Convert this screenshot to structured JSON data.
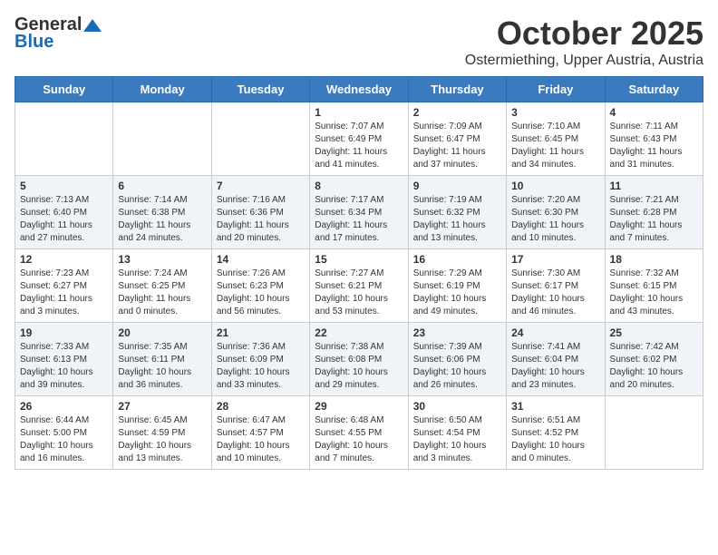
{
  "header": {
    "logo_general": "General",
    "logo_blue": "Blue",
    "month": "October 2025",
    "location": "Ostermiething, Upper Austria, Austria"
  },
  "weekdays": [
    "Sunday",
    "Monday",
    "Tuesday",
    "Wednesday",
    "Thursday",
    "Friday",
    "Saturday"
  ],
  "weeks": [
    [
      {
        "day": "",
        "info": ""
      },
      {
        "day": "",
        "info": ""
      },
      {
        "day": "",
        "info": ""
      },
      {
        "day": "1",
        "info": "Sunrise: 7:07 AM\nSunset: 6:49 PM\nDaylight: 11 hours\nand 41 minutes."
      },
      {
        "day": "2",
        "info": "Sunrise: 7:09 AM\nSunset: 6:47 PM\nDaylight: 11 hours\nand 37 minutes."
      },
      {
        "day": "3",
        "info": "Sunrise: 7:10 AM\nSunset: 6:45 PM\nDaylight: 11 hours\nand 34 minutes."
      },
      {
        "day": "4",
        "info": "Sunrise: 7:11 AM\nSunset: 6:43 PM\nDaylight: 11 hours\nand 31 minutes."
      }
    ],
    [
      {
        "day": "5",
        "info": "Sunrise: 7:13 AM\nSunset: 6:40 PM\nDaylight: 11 hours\nand 27 minutes."
      },
      {
        "day": "6",
        "info": "Sunrise: 7:14 AM\nSunset: 6:38 PM\nDaylight: 11 hours\nand 24 minutes."
      },
      {
        "day": "7",
        "info": "Sunrise: 7:16 AM\nSunset: 6:36 PM\nDaylight: 11 hours\nand 20 minutes."
      },
      {
        "day": "8",
        "info": "Sunrise: 7:17 AM\nSunset: 6:34 PM\nDaylight: 11 hours\nand 17 minutes."
      },
      {
        "day": "9",
        "info": "Sunrise: 7:19 AM\nSunset: 6:32 PM\nDaylight: 11 hours\nand 13 minutes."
      },
      {
        "day": "10",
        "info": "Sunrise: 7:20 AM\nSunset: 6:30 PM\nDaylight: 11 hours\nand 10 minutes."
      },
      {
        "day": "11",
        "info": "Sunrise: 7:21 AM\nSunset: 6:28 PM\nDaylight: 11 hours\nand 7 minutes."
      }
    ],
    [
      {
        "day": "12",
        "info": "Sunrise: 7:23 AM\nSunset: 6:27 PM\nDaylight: 11 hours\nand 3 minutes."
      },
      {
        "day": "13",
        "info": "Sunrise: 7:24 AM\nSunset: 6:25 PM\nDaylight: 11 hours\nand 0 minutes."
      },
      {
        "day": "14",
        "info": "Sunrise: 7:26 AM\nSunset: 6:23 PM\nDaylight: 10 hours\nand 56 minutes."
      },
      {
        "day": "15",
        "info": "Sunrise: 7:27 AM\nSunset: 6:21 PM\nDaylight: 10 hours\nand 53 minutes."
      },
      {
        "day": "16",
        "info": "Sunrise: 7:29 AM\nSunset: 6:19 PM\nDaylight: 10 hours\nand 49 minutes."
      },
      {
        "day": "17",
        "info": "Sunrise: 7:30 AM\nSunset: 6:17 PM\nDaylight: 10 hours\nand 46 minutes."
      },
      {
        "day": "18",
        "info": "Sunrise: 7:32 AM\nSunset: 6:15 PM\nDaylight: 10 hours\nand 43 minutes."
      }
    ],
    [
      {
        "day": "19",
        "info": "Sunrise: 7:33 AM\nSunset: 6:13 PM\nDaylight: 10 hours\nand 39 minutes."
      },
      {
        "day": "20",
        "info": "Sunrise: 7:35 AM\nSunset: 6:11 PM\nDaylight: 10 hours\nand 36 minutes."
      },
      {
        "day": "21",
        "info": "Sunrise: 7:36 AM\nSunset: 6:09 PM\nDaylight: 10 hours\nand 33 minutes."
      },
      {
        "day": "22",
        "info": "Sunrise: 7:38 AM\nSunset: 6:08 PM\nDaylight: 10 hours\nand 29 minutes."
      },
      {
        "day": "23",
        "info": "Sunrise: 7:39 AM\nSunset: 6:06 PM\nDaylight: 10 hours\nand 26 minutes."
      },
      {
        "day": "24",
        "info": "Sunrise: 7:41 AM\nSunset: 6:04 PM\nDaylight: 10 hours\nand 23 minutes."
      },
      {
        "day": "25",
        "info": "Sunrise: 7:42 AM\nSunset: 6:02 PM\nDaylight: 10 hours\nand 20 minutes."
      }
    ],
    [
      {
        "day": "26",
        "info": "Sunrise: 6:44 AM\nSunset: 5:00 PM\nDaylight: 10 hours\nand 16 minutes."
      },
      {
        "day": "27",
        "info": "Sunrise: 6:45 AM\nSunset: 4:59 PM\nDaylight: 10 hours\nand 13 minutes."
      },
      {
        "day": "28",
        "info": "Sunrise: 6:47 AM\nSunset: 4:57 PM\nDaylight: 10 hours\nand 10 minutes."
      },
      {
        "day": "29",
        "info": "Sunrise: 6:48 AM\nSunset: 4:55 PM\nDaylight: 10 hours\nand 7 minutes."
      },
      {
        "day": "30",
        "info": "Sunrise: 6:50 AM\nSunset: 4:54 PM\nDaylight: 10 hours\nand 3 minutes."
      },
      {
        "day": "31",
        "info": "Sunrise: 6:51 AM\nSunset: 4:52 PM\nDaylight: 10 hours\nand 0 minutes."
      },
      {
        "day": "",
        "info": ""
      }
    ]
  ]
}
